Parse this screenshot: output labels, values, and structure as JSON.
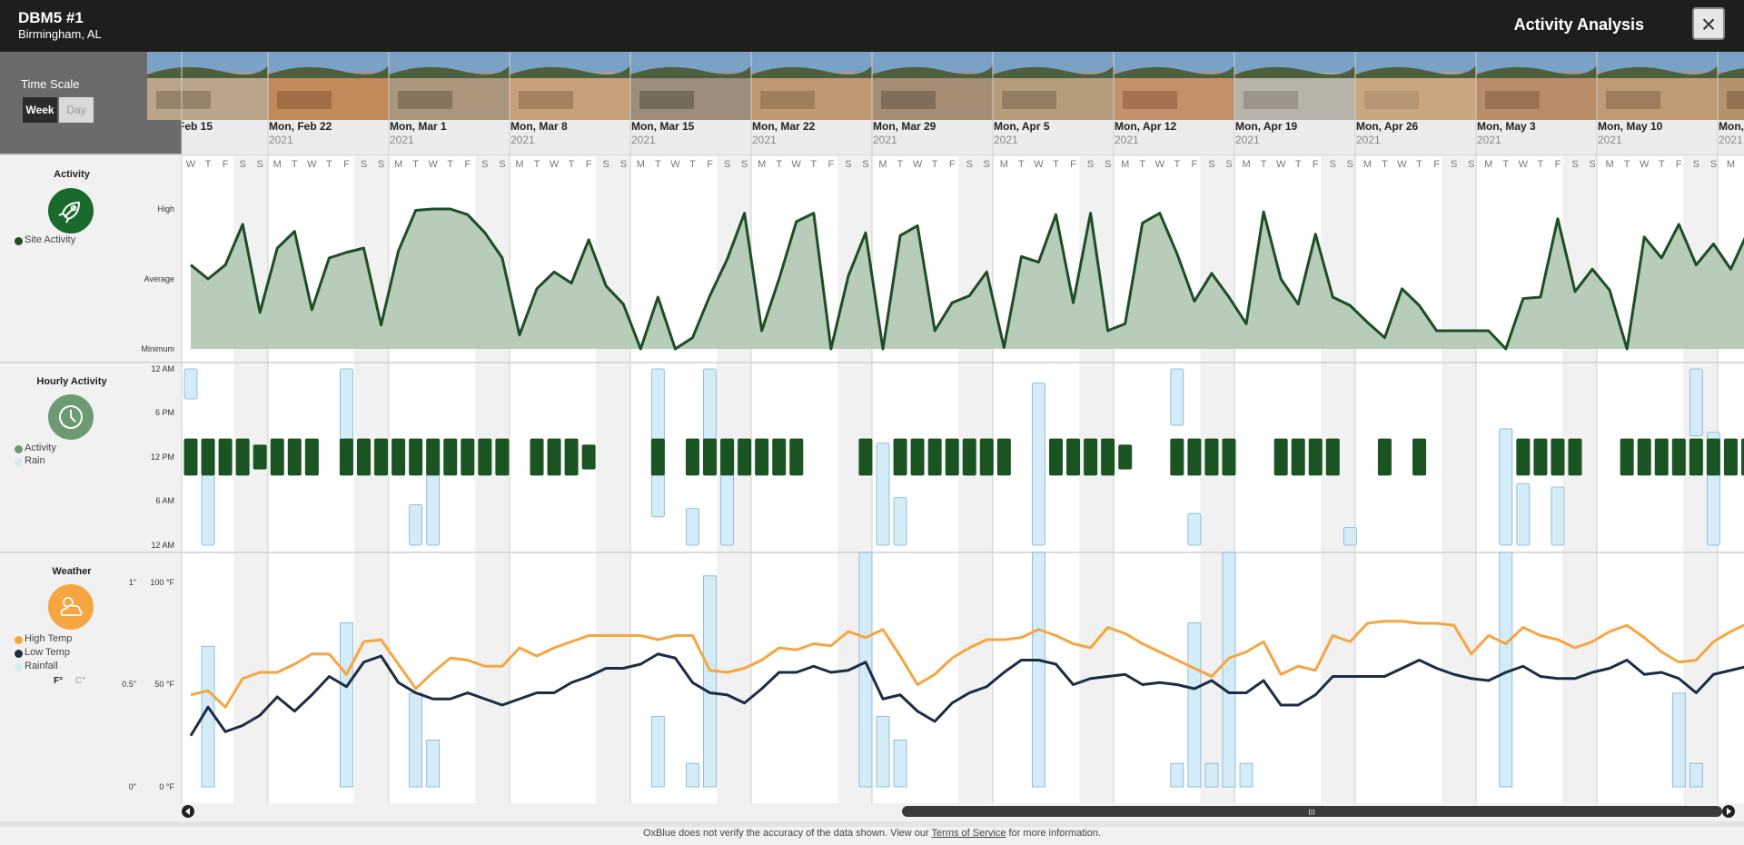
{
  "header": {
    "site_name": "DBM5 #1",
    "location": "Birmingham, AL",
    "title": "Activity Analysis",
    "close_icon": "close-icon"
  },
  "time_scale": {
    "label": "Time Scale",
    "options": [
      "Week",
      "Day"
    ],
    "selected": "Week"
  },
  "weeks": [
    {
      "label": "Feb 15",
      "year": ""
    },
    {
      "label": "Mon, Feb 22",
      "year": "2021"
    },
    {
      "label": "Mon, Mar 1",
      "year": "2021"
    },
    {
      "label": "Mon, Mar 8",
      "year": "2021"
    },
    {
      "label": "Mon, Mar 15",
      "year": "2021"
    },
    {
      "label": "Mon, Mar 22",
      "year": "2021"
    },
    {
      "label": "Mon, Mar 29",
      "year": "2021"
    },
    {
      "label": "Mon, Apr 5",
      "year": "2021"
    },
    {
      "label": "Mon, Apr 12",
      "year": "2021"
    },
    {
      "label": "Mon, Apr 19",
      "year": "2021"
    },
    {
      "label": "Mon, Apr 26",
      "year": "2021"
    },
    {
      "label": "Mon, May 3",
      "year": "2021"
    },
    {
      "label": "Mon, May 10",
      "year": "2021"
    },
    {
      "label": "Mon,",
      "year": "2021"
    }
  ],
  "day_letters": [
    "M",
    "T",
    "W",
    "T",
    "F",
    "S",
    "S"
  ],
  "activity": {
    "title": "Activity",
    "icon": "rocket-icon",
    "legend": "Site Activity",
    "y_labels": [
      "High",
      "Average",
      "Minimum"
    ]
  },
  "hourly": {
    "title": "Hourly Activity",
    "icon": "clock-icon",
    "legend": [
      "Activity",
      "Rain"
    ],
    "y_labels": [
      "12 AM",
      "6 PM",
      "12 PM",
      "6 AM",
      "12 AM"
    ]
  },
  "weather": {
    "title": "Weather",
    "icon": "sun-cloud-icon",
    "legend": [
      "High Temp",
      "Low Temp",
      "Rainfall"
    ],
    "units": [
      "F°",
      "C°"
    ],
    "selected_unit": "F°",
    "rain_labels": [
      "1\"",
      "0.5\"",
      "0\""
    ],
    "temp_labels": [
      "100 °F",
      "50 °F",
      "0 °F"
    ]
  },
  "colors": {
    "activity_line": "#1e4d26",
    "activity_fill": "#b7cdb9",
    "hourly_bar": "#1a5423",
    "rain": "#d3ecf8",
    "high_temp": "#f5a641",
    "low_temp": "#1d2b45",
    "weather_icon": "#f5a641",
    "activity_icon": "#1a6a2c",
    "hourly_icon": "#6e9a73"
  },
  "chart_data": [
    {
      "type": "area",
      "title": "Activity",
      "ylabel": "",
      "y_ticks": [
        "Minimum",
        "Average",
        "High"
      ],
      "ylim": [
        0,
        1
      ],
      "series": [
        {
          "name": "Site Activity",
          "values": [
            0.6,
            0.5,
            0.6,
            0.89,
            0.26,
            0.72,
            0.84,
            0.28,
            0.65,
            0.69,
            0.72,
            0.17,
            0.7,
            0.99,
            1.0,
            1.0,
            0.96,
            0.83,
            0.65,
            0.1,
            0.43,
            0.55,
            0.47,
            0.78,
            0.45,
            0.32,
            0.0,
            0.37,
            0.0,
            0.08,
            0.38,
            0.64,
            0.97,
            0.13,
            0.5,
            0.91,
            0.97,
            0.0,
            0.52,
            0.83,
            0.0,
            0.81,
            0.88,
            0.13,
            0.33,
            0.38,
            0.55,
            0.01,
            0.66,
            0.62,
            0.96,
            0.33,
            0.97,
            0.13,
            0.18,
            0.9,
            0.97,
            0.68,
            0.34,
            0.54,
            0.37,
            0.18,
            0.98,
            0.5,
            0.32,
            0.82,
            0.37,
            0.31,
            0.19,
            0.08,
            0.43,
            0.31,
            0.13,
            0.13,
            0.13,
            0.13,
            0.0,
            0.36,
            0.37,
            0.93,
            0.41,
            0.57,
            0.42,
            0.0,
            0.8,
            0.65,
            0.89,
            0.6,
            0.75,
            0.57,
            0.84
          ]
        }
      ]
    },
    {
      "type": "bar",
      "title": "Hourly Activity",
      "y_ticks": [
        "12 AM",
        "6 PM",
        "12 PM",
        "6 AM",
        "12 AM"
      ],
      "series": [
        {
          "name": "Activity",
          "values": [
            0.15,
            0.15,
            0.15,
            0.15,
            0.1,
            0.15,
            0.15,
            0.15,
            0.0,
            0.15,
            0.15,
            0.15,
            0.15,
            0.15,
            0.15,
            0.15,
            0.15,
            0.15,
            0.15,
            0.0,
            0.15,
            0.15,
            0.15,
            0.1,
            0.0,
            0.0,
            0.0,
            0.15,
            0.0,
            0.15,
            0.15,
            0.15,
            0.15,
            0.15,
            0.15,
            0.15,
            0.0,
            0.0,
            0.0,
            0.15,
            0.0,
            0.15,
            0.15,
            0.15,
            0.15,
            0.15,
            0.15,
            0.15,
            0.0,
            0.0,
            0.15,
            0.15,
            0.15,
            0.15,
            0.1,
            0.0,
            0.0,
            0.15,
            0.15,
            0.15,
            0.15,
            0.0,
            0.0,
            0.15,
            0.15,
            0.15,
            0.15,
            0.0,
            0.0,
            0.15,
            0.0,
            0.15,
            0.0,
            0.0,
            0.0,
            0.0,
            0.0,
            0.15,
            0.15,
            0.15,
            0.15,
            0.0,
            0.0,
            0.15,
            0.15,
            0.15,
            0.15,
            0.15,
            0.15,
            0.15,
            0.15
          ]
        },
        {
          "name": "Rain",
          "values": [
            0.17,
            0.4,
            0,
            0,
            0,
            0,
            0,
            0,
            0,
            0.6,
            0,
            0,
            0,
            0.23,
            0.48,
            0,
            0,
            0,
            0,
            0,
            0,
            0,
            0,
            0,
            0,
            0,
            0,
            0.84,
            0,
            0.21,
            0.5,
            0.46,
            0,
            0,
            0,
            0,
            0,
            0,
            0,
            0,
            0.58,
            0.27,
            0,
            0,
            0,
            0,
            0,
            0,
            0,
            0.92,
            0,
            0,
            0,
            0,
            0,
            0,
            0,
            0.32,
            0.18,
            0,
            0,
            0,
            0,
            0,
            0,
            0,
            0,
            0.1,
            0,
            0,
            0,
            0,
            0,
            0,
            0,
            0,
            0.66,
            0.35,
            0,
            0.33,
            0,
            0,
            0,
            0,
            0,
            0,
            0,
            0.38,
            0.64,
            0,
            0
          ]
        }
      ]
    },
    {
      "type": "line",
      "title": "Weather",
      "y_ticks": [
        "0 °F",
        "50 °F",
        "100 °F"
      ],
      "ylim": [
        0,
        100
      ],
      "rain_ylim": [
        0,
        1
      ],
      "series": [
        {
          "name": "High Temp",
          "values": [
            45,
            47,
            39,
            53,
            56,
            56,
            60,
            65,
            65,
            55,
            71,
            72,
            60,
            48,
            56,
            63,
            62,
            59,
            59,
            68,
            64,
            68,
            71,
            74,
            74,
            74,
            74,
            72,
            74,
            74,
            57,
            56,
            58,
            62,
            68,
            67,
            70,
            69,
            76,
            73,
            77,
            64,
            50,
            55,
            63,
            68,
            72,
            72,
            73,
            77,
            74,
            70,
            68,
            78,
            75,
            70,
            66,
            62,
            58,
            54,
            63,
            66,
            71,
            55,
            59,
            57,
            74,
            71,
            80,
            81,
            81,
            80,
            80,
            79,
            65,
            74,
            70,
            78,
            74,
            72,
            68,
            71,
            76,
            79,
            73,
            66,
            61,
            62,
            71,
            76,
            80,
            78
          ]
        },
        {
          "name": "Low Temp",
          "values": [
            25,
            39,
            27,
            30,
            35,
            44,
            37,
            45,
            54,
            49,
            61,
            64,
            51,
            46,
            43,
            43,
            46,
            43,
            40,
            43,
            46,
            46,
            51,
            54,
            58,
            58,
            60,
            65,
            63,
            51,
            46,
            45,
            41,
            48,
            56,
            56,
            59,
            56,
            57,
            61,
            43,
            45,
            37,
            32,
            41,
            46,
            49,
            56,
            62,
            62,
            60,
            50,
            53,
            54,
            55,
            50,
            51,
            50,
            48,
            52,
            46,
            46,
            52,
            40,
            40,
            45,
            54,
            54,
            54,
            54,
            58,
            62,
            58,
            55,
            53,
            52,
            56,
            59,
            54,
            53,
            53,
            56,
            58,
            62,
            55,
            56,
            53,
            46,
            55,
            57,
            59
          ]
        },
        {
          "name": "Rainfall",
          "values": [
            0,
            0.6,
            0,
            0,
            0,
            0,
            0,
            0,
            0,
            0.7,
            0,
            0,
            0,
            0.4,
            0.2,
            0,
            0,
            0,
            0,
            0,
            0,
            0,
            0,
            0,
            0,
            0,
            0,
            0.3,
            0,
            0.1,
            0.9,
            0,
            0,
            0,
            0,
            0,
            0,
            0,
            0,
            1.0,
            0.3,
            0.2,
            0,
            0,
            0,
            0,
            0,
            0,
            0,
            1.0,
            0,
            0,
            0,
            0,
            0,
            0,
            0,
            0.1,
            0.7,
            0.1,
            1.0,
            0.1,
            0,
            0,
            0,
            0,
            0,
            0,
            0,
            0,
            0,
            0,
            0,
            0,
            0,
            0,
            1.0,
            0,
            0,
            0,
            0,
            0,
            0,
            0,
            0,
            0,
            0.4,
            0.1,
            0,
            0,
            0,
            0,
            0,
            0,
            1.0,
            0.1,
            0,
            0,
            0
          ]
        }
      ]
    }
  ],
  "footer": {
    "text_before": "OxBlue does not verify the accuracy of the data shown. View our ",
    "link": "Terms of Service",
    "text_after": " for more information."
  },
  "scrollbar": {
    "left_arrow": "scroll-left-icon",
    "right_arrow": "scroll-right-icon",
    "grip": "III"
  }
}
